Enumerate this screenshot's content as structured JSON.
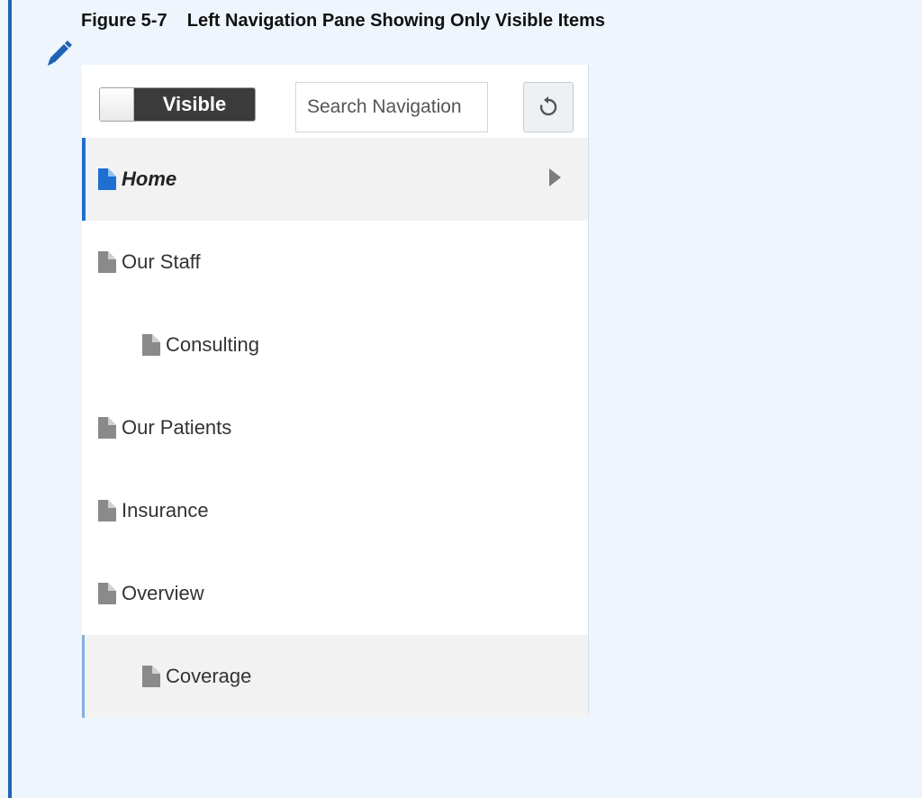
{
  "figure": {
    "title": "Figure 5-7    Left Navigation Pane Showing Only Visible Items"
  },
  "toolbar": {
    "toggle_label": "Visible",
    "search_placeholder": "Search Navigation"
  },
  "nav": {
    "items": [
      {
        "label": "Home",
        "level": 0,
        "selected": true,
        "has_children": true,
        "icon": "document-icon"
      },
      {
        "label": "Our Staff",
        "level": 0,
        "icon": "document-icon"
      },
      {
        "label": "Consulting",
        "level": 1,
        "icon": "document-icon"
      },
      {
        "label": "Our Patients",
        "level": 0,
        "icon": "document-icon"
      },
      {
        "label": "Insurance",
        "level": 0,
        "icon": "document-icon"
      },
      {
        "label": "Overview",
        "level": 0,
        "icon": "document-icon"
      },
      {
        "label": "Coverage",
        "level": 1,
        "hover": true,
        "icon": "document-icon"
      }
    ]
  },
  "colors": {
    "accent": "#1f6fd0",
    "doc_icon": "#8a8a8a",
    "selected_doc_icon": "#1f6fd0"
  }
}
